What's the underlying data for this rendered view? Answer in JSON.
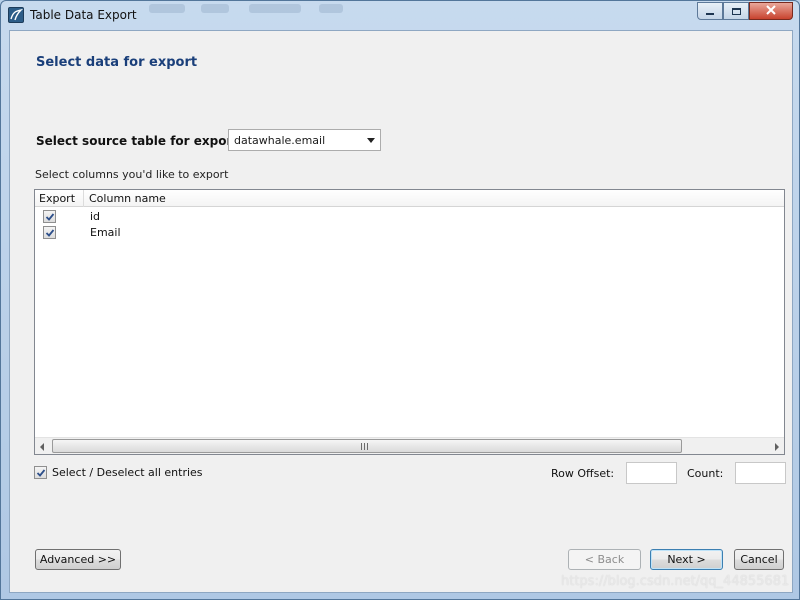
{
  "window": {
    "title": "Table Data Export",
    "caption_buttons": [
      "minimize-icon",
      "maximize-icon",
      "close-icon"
    ]
  },
  "page": {
    "heading": "Select data for export",
    "source_label": "Select source table for export:",
    "source_value": "datawhale.email",
    "columns_label": "Select columns you'd like to export"
  },
  "grid": {
    "headers": [
      "Export",
      "Column name"
    ],
    "rows": [
      {
        "checked": true,
        "name": "id"
      },
      {
        "checked": true,
        "name": "Email"
      }
    ],
    "scroll_grip": "III"
  },
  "options": {
    "select_all_label": "Select / Deselect all entries",
    "select_all_checked": true,
    "row_offset_label": "Row Offset:",
    "row_offset_value": "",
    "count_label": "Count:",
    "count_value": ""
  },
  "buttons": {
    "advanced": "Advanced >>",
    "back": "< Back",
    "next": "Next >",
    "cancel": "Cancel"
  },
  "watermark": "https://blog.csdn.net/qq_44855681",
  "colors": {
    "heading": "#1a3f7a",
    "client_bg": "#f0f0f0",
    "titlebar": "#c7daee",
    "close_button": "#c8432e"
  }
}
